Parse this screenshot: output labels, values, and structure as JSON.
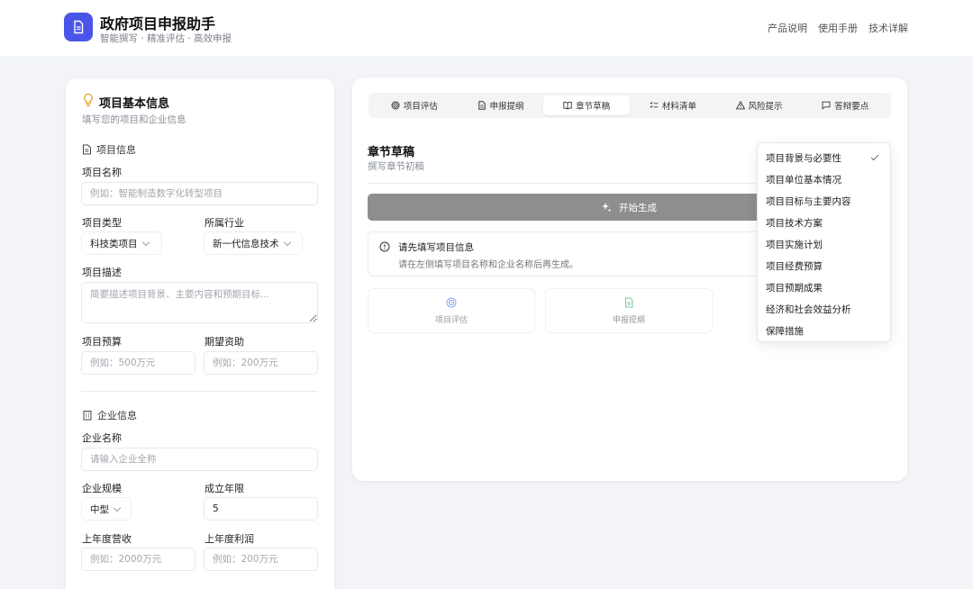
{
  "header": {
    "title": "政府项目申报助手",
    "subtitle": "智能撰写 · 精准评估 · 高效申报",
    "links": [
      "产品说明",
      "使用手册",
      "技术详解"
    ]
  },
  "left_panel": {
    "title": "项目基本信息",
    "subtitle": "填写您的项目和企业信息",
    "project_section": {
      "heading": "项目信息",
      "name_label": "项目名称",
      "name_placeholder": "例如：智能制造数字化转型项目",
      "type_label": "项目类型",
      "type_value": "科技类项目",
      "industry_label": "所属行业",
      "industry_value": "新一代信息技术",
      "desc_label": "项目描述",
      "desc_placeholder": "简要描述项目背景、主要内容和预期目标...",
      "budget_label": "项目预算",
      "budget_placeholder": "例如：500万元",
      "funding_label": "期望资助",
      "funding_placeholder": "例如：200万元"
    },
    "company_section": {
      "heading": "企业信息",
      "name_label": "企业名称",
      "name_placeholder": "请输入企业全称",
      "scale_label": "企业规模",
      "scale_value": "中型",
      "years_label": "成立年限",
      "years_value": "5",
      "revenue_label": "上年度营收",
      "revenue_placeholder": "例如：2000万元",
      "profit_label": "上年度利润",
      "profit_placeholder": "例如：200万元"
    }
  },
  "right_panel": {
    "tabs": [
      {
        "label": "项目评估",
        "icon": "target-icon"
      },
      {
        "label": "申报提纲",
        "icon": "document-icon"
      },
      {
        "label": "章节草稿",
        "icon": "book-icon"
      },
      {
        "label": "材料清单",
        "icon": "checklist-icon"
      },
      {
        "label": "风险提示",
        "icon": "warning-icon"
      },
      {
        "label": "答辩要点",
        "icon": "message-icon"
      }
    ],
    "active_tab": "章节草稿",
    "section_title": "章节草稿",
    "section_subtitle": "撰写章节初稿",
    "generate_label": "开始生成",
    "notice_title": "请先填写项目信息",
    "notice_text": "请在左侧填写项目名称和企业名称后再生成。",
    "mini_cards": [
      "项目评估",
      "申报提纲"
    ],
    "chapter_options": [
      "项目背景与必要性",
      "项目单位基本情况",
      "项目目标与主要内容",
      "项目技术方案",
      "项目实施计划",
      "项目经费预算",
      "项目预期成果",
      "经济和社会效益分析",
      "保障措施"
    ],
    "selected_chapter": "项目背景与必要性"
  },
  "colors": {
    "brand": "#4a54e8",
    "button_disabled": "#8e8e8e",
    "page_bg": "#f2f4f8"
  }
}
